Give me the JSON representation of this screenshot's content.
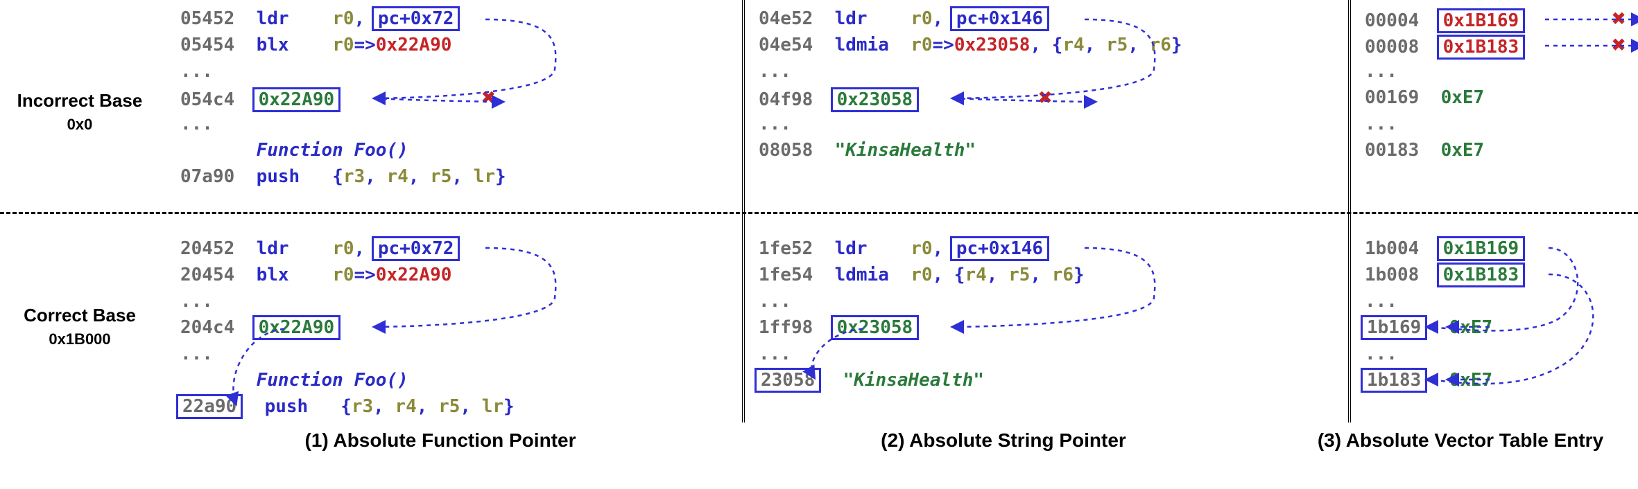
{
  "labels": {
    "incorrect_title": "Incorrect Base",
    "incorrect_sub": "0x0",
    "correct_title": "Correct Base",
    "correct_sub": "0x1B000"
  },
  "asm": {
    "ldr": "ldr",
    "blx": "blx",
    "ldmia": "ldmia",
    "push": "push",
    "ellipsis": "..."
  },
  "regs": {
    "r0": "r0",
    "r3": "r3",
    "r4": "r4",
    "r5": "r5",
    "r6": "r6",
    "lr": "lr"
  },
  "col1": {
    "caption": "(1) Absolute Function Pointer",
    "top": {
      "a1": "05452",
      "pcimm": "pc+0x72",
      "a2": "05454",
      "arrow_to": "0x22A90",
      "a3": "054c4",
      "val": "0x22A90",
      "fn": "Function Foo()",
      "a4": "07a90"
    },
    "bot": {
      "a1": "20452",
      "pcimm": "pc+0x72",
      "a2": "20454",
      "arrow_to": "0x22A90",
      "a3": "204c4",
      "val": "0x22A90",
      "fn": "Function Foo()",
      "a4": "22a90"
    }
  },
  "col2": {
    "caption": "(2) Absolute String Pointer",
    "top": {
      "a1": "04e52",
      "pcimm": "pc+0x146",
      "a2": "04e54",
      "arrow_to": "0x23058",
      "a3": "04f98",
      "val": "0x23058",
      "a4": "08058",
      "str": "\"KinsaHealth\""
    },
    "bot": {
      "a1": "1fe52",
      "pcimm": "pc+0x146",
      "a2": "1fe54",
      "a3": "1ff98",
      "val": "0x23058",
      "a4": "23058",
      "str": "\"KinsaHealth\""
    }
  },
  "col3": {
    "caption": "(3) Absolute Vector Table Entry",
    "top": {
      "a1": "00004",
      "v1": "0x1B169",
      "a2": "00008",
      "v2": "0x1B183",
      "a3": "00169",
      "e": "0xE7",
      "a4": "00183"
    },
    "bot": {
      "a1": "1b004",
      "v1": "0x1B169",
      "a2": "1b008",
      "v2": "0x1B183",
      "a3": "1b169",
      "e": "0xE7",
      "a4": "1b183"
    }
  },
  "arrow_style": {
    "dash": "6 6",
    "color": "#2f2fd6",
    "width": 2.5
  }
}
